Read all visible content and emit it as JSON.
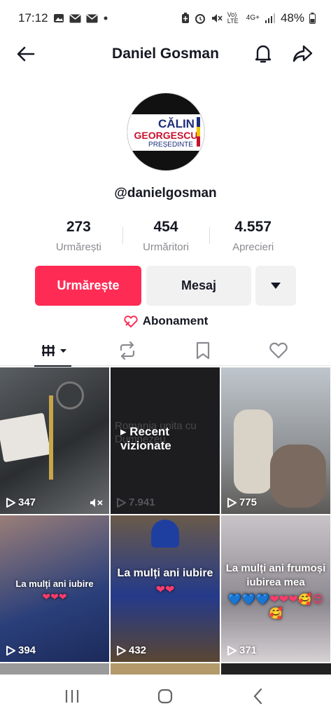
{
  "status_bar": {
    "time": "17:12",
    "network": "Vo) LTE",
    "signal": "4G+",
    "battery": "48%",
    "icons": [
      "gallery-icon",
      "mail-icon",
      "mail-icon",
      "dot-icon",
      "battery-saver-icon",
      "alarm-icon",
      "mute-icon",
      "wifi-calling-icon",
      "signal-icon",
      "battery-icon"
    ]
  },
  "header": {
    "title": "Daniel Gosman",
    "icons": [
      "back-arrow-icon",
      "bell-icon",
      "share-icon"
    ]
  },
  "profile": {
    "avatar_text": {
      "line1": "CĂLIN",
      "line2": "GEORGESCU",
      "line3": "PREȘEDINTE"
    },
    "handle": "@danielgosman",
    "stats": [
      {
        "value": "273",
        "label": "Urmărești"
      },
      {
        "value": "454",
        "label": "Urmăritori"
      },
      {
        "value": "4.557",
        "label": "Aprecieri"
      }
    ]
  },
  "actions": {
    "follow_label": "Urmărește",
    "message_label": "Mesaj",
    "subscription_label": "Abonament"
  },
  "tabs": [
    "videos-tab",
    "reposts-tab",
    "favorites-tab",
    "liked-tab"
  ],
  "videos": [
    {
      "views": "347",
      "caption": "",
      "muted": true
    },
    {
      "views": "7.941",
      "caption": "Recent vizionate",
      "overlay_text": "Romania unita cu Dumnezeu",
      "watched": true
    },
    {
      "views": "775",
      "caption": ""
    },
    {
      "views": "394",
      "caption": "La mulți ani iubire",
      "emoji": "❤❤❤"
    },
    {
      "views": "432",
      "caption": "La mulți ani iubire",
      "emoji": "❤❤"
    },
    {
      "views": "371",
      "caption": "La mulți ani frumoși iubirea mea",
      "emoji": "💙💙💙❤❤❤🥰😍🥰"
    }
  ],
  "colors": {
    "accent": "#fe2c55",
    "text": "#161823",
    "muted": "#8a8b91"
  },
  "nav_bar": [
    "recent-apps-icon",
    "home-icon",
    "back-icon"
  ]
}
